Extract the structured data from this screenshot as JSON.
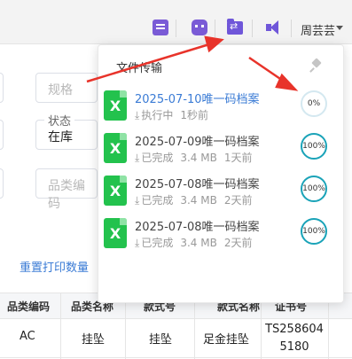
{
  "topbar": {
    "user_name": "周芸芸",
    "icons": [
      "clipboard-icon",
      "robot-icon",
      "file-transfer-icon",
      "announcement-icon"
    ]
  },
  "form": {
    "spec_placeholder": "规格",
    "status_label": "状态",
    "status_value": "在库",
    "category_code_placeholder": "品类编码",
    "reset_print_count": "重置打印数量"
  },
  "table": {
    "headers": [
      "品类编码",
      "品类名称",
      "款式号",
      "款式名称",
      "证书号"
    ],
    "row": [
      "AC",
      "挂坠",
      "挂坠",
      "足金挂坠",
      "TS258604\n5180"
    ]
  },
  "popover": {
    "title": "文件传输",
    "items": [
      {
        "name": "2025-07-10唯一码档案",
        "status": "执行中",
        "size": "",
        "time": "1秒前",
        "progress": "0%",
        "active": true
      },
      {
        "name": "2025-07-09唯一码档案",
        "status": "已完成",
        "size": "3.4 MB",
        "time": "1天前",
        "progress": "100%",
        "active": false
      },
      {
        "name": "2025-07-08唯一码档案",
        "status": "已完成",
        "size": "3.4 MB",
        "time": "2天前",
        "progress": "100%",
        "active": false
      },
      {
        "name": "2025-07-08唯一码档案",
        "status": "已完成",
        "size": "3.4 MB",
        "time": "2天前",
        "progress": "100%",
        "active": false
      }
    ]
  },
  "colors": {
    "accent": "#3a7bd5",
    "progress_ring": "#1aa3b8",
    "excel_green": "#23c24d",
    "annotation_red": "#e8332a",
    "icon_purple": "#6f56d9"
  }
}
